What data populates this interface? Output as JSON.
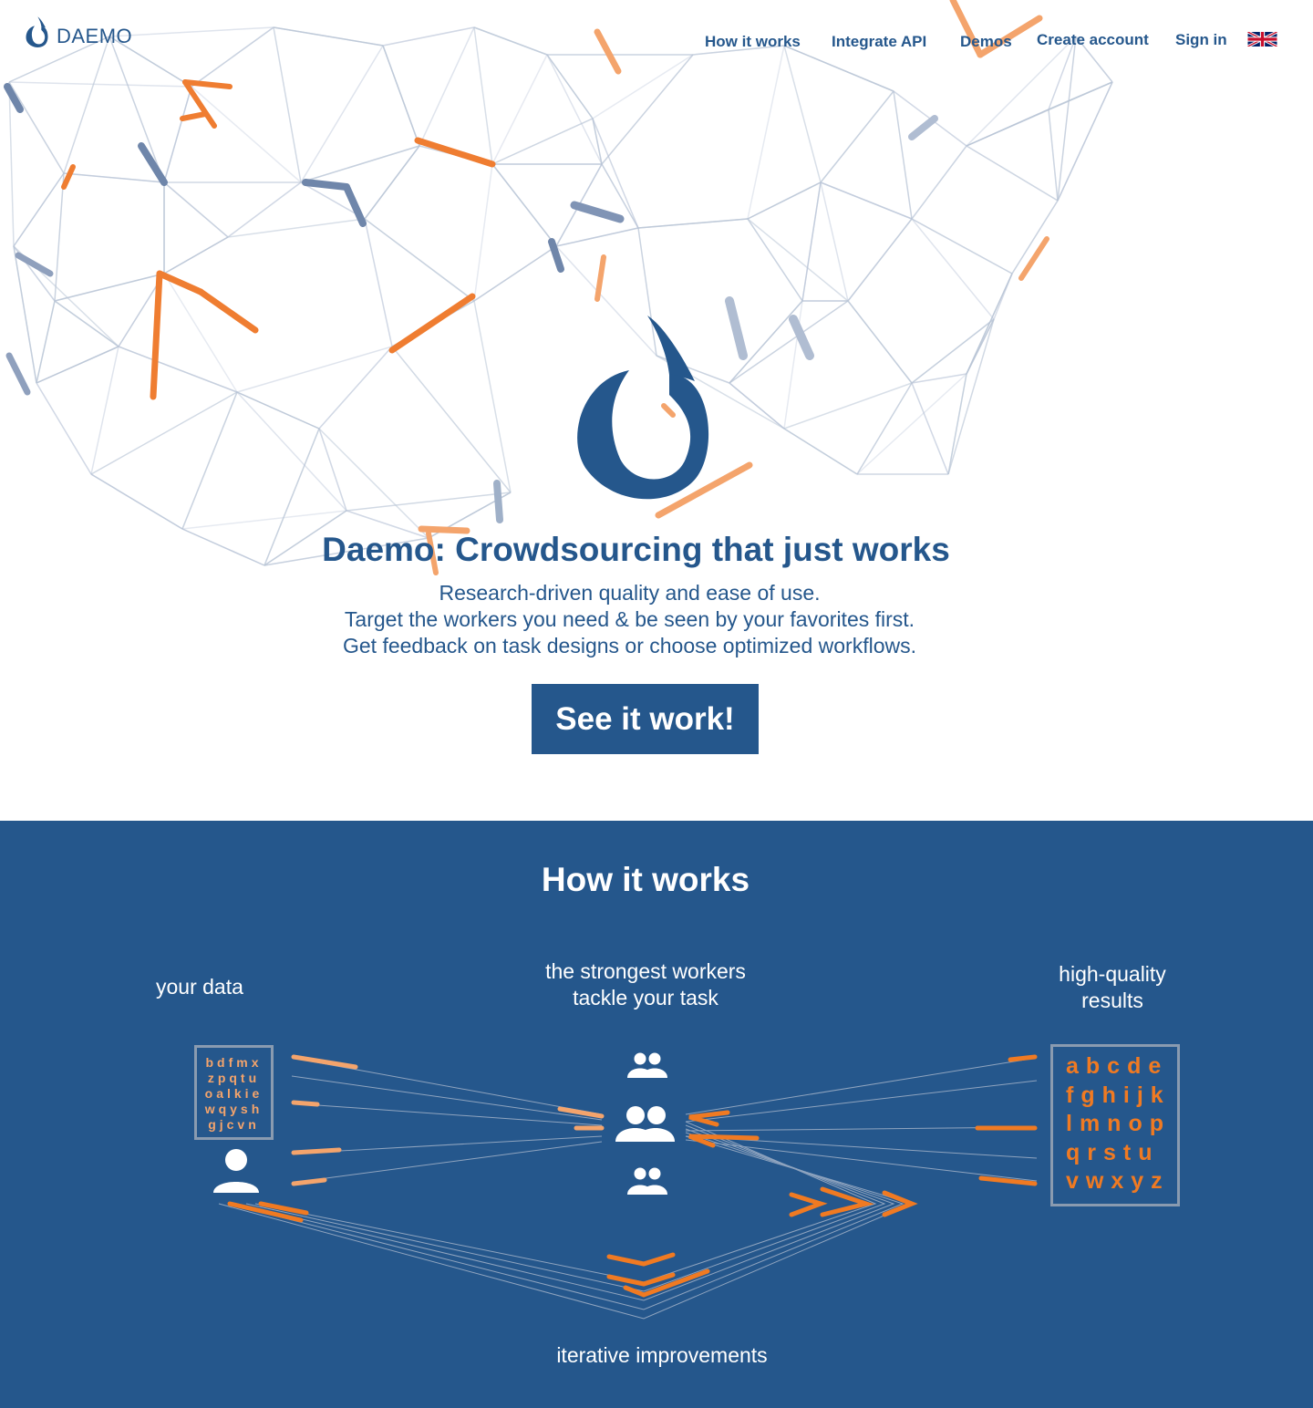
{
  "brand": {
    "name": "DAEMO",
    "logo_icon": "daemo-logo-icon"
  },
  "nav": {
    "items": [
      {
        "label": "How it works"
      },
      {
        "label": "Integrate API"
      },
      {
        "label": "Demos"
      },
      {
        "label": "Create account"
      },
      {
        "label": "Sign in"
      }
    ],
    "language_icon": "uk-flag-icon"
  },
  "hero": {
    "title": "Daemo: Crowdsourcing that just works",
    "subtitle_lines": [
      "Research-driven quality and ease of use.",
      "Target the workers you need & be seen by your favorites first.",
      "Get feedback on task designs or choose optimized workflows."
    ],
    "cta_label": "See it work!"
  },
  "how_it_works": {
    "title": "How it works",
    "your_data_label": "your data",
    "workers_label_lines": [
      "the strongest workers",
      "tackle your task"
    ],
    "results_label_lines": [
      "high-quality",
      "results"
    ],
    "iterative_label": "iterative improvements",
    "data_box_rows": [
      "bdfmx",
      "zpqtu",
      "oalkie",
      "wqysh",
      "gjcvn"
    ],
    "results_box_rows": [
      "abcde",
      "fghijk",
      "lmnop",
      "qrstu",
      "vwxyz"
    ],
    "icons": [
      "user-icon",
      "group-icon"
    ]
  },
  "colors": {
    "primary": "#25578c",
    "accent_orange": "#f07a22",
    "light_orange": "#f4a46c",
    "white": "#ffffff"
  }
}
